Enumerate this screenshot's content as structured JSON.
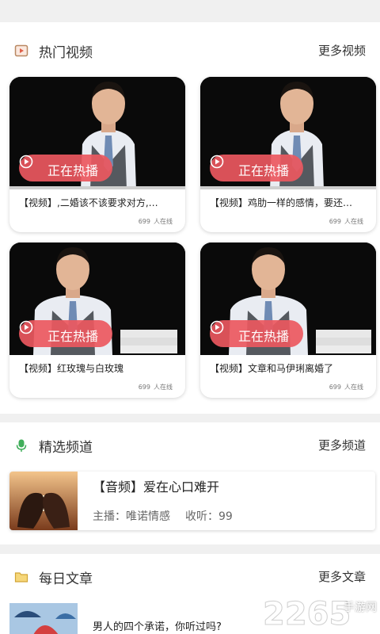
{
  "hot_videos": {
    "title": "热门视频",
    "more": "更多视频",
    "badge": "正在热播",
    "items": [
      {
        "title": "【视频】,二婚该不该要求对方,…",
        "count": "699",
        "online": "人在线"
      },
      {
        "title": "【视频】鸡肋一样的感情，要还…",
        "count": "699",
        "online": "人在线"
      },
      {
        "title": "【视频】红玫瑰与白玫瑰",
        "count": "699",
        "online": "人在线"
      },
      {
        "title": "【视频】文章和马伊琍离婚了",
        "count": "699",
        "online": "人在线"
      }
    ]
  },
  "channels": {
    "title": "精选频道",
    "more": "更多频道",
    "items": [
      {
        "title": "【音频】爱在心口难开",
        "host": "主播：唯诺情感",
        "listens": "收听：99"
      }
    ]
  },
  "articles": {
    "title": "每日文章",
    "more": "更多文章",
    "items": [
      {
        "title": "男人的四个承诺，你听过吗?"
      }
    ]
  },
  "watermark": {
    "brand": "2265",
    "sub": "手游网"
  },
  "colors": {
    "accent": "#ec585f",
    "section_bg": "#ffffff",
    "page_bg": "#f0f0f0"
  },
  "icons": {
    "hot": "video-icon",
    "channel": "microphone-icon",
    "article": "folder-icon"
  }
}
